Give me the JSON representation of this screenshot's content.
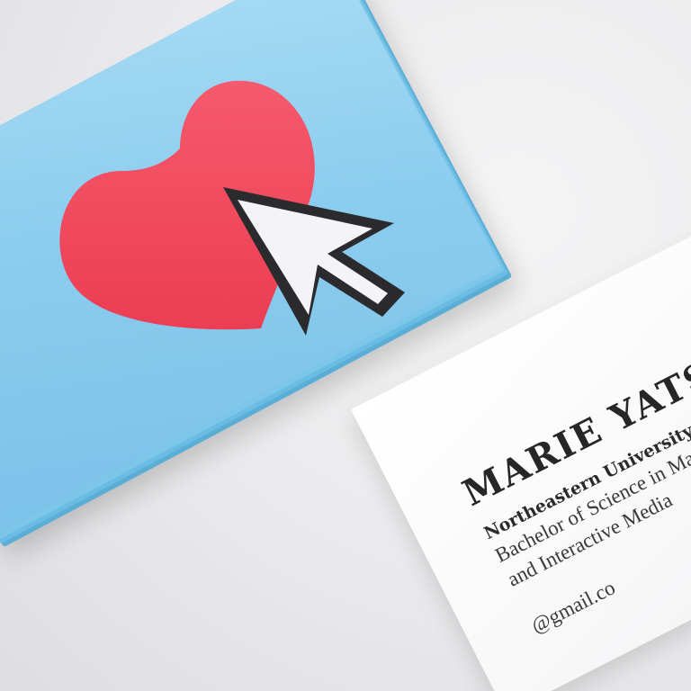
{
  "white_card": {
    "name": "MARIE YATSYK",
    "school": "Northeastern University Class",
    "degree_line1": "Bachelor of Science in Marke",
    "degree_line2": "and Interactive Media",
    "email_partial": "@gmail.co"
  },
  "blue_card": {
    "graphic": "heart-with-cursor",
    "colors": {
      "card": "#8dcdef",
      "heart": "#f04a5e",
      "cursor_fill": "#f4f4f6",
      "cursor_outline": "#2b2b2d"
    }
  }
}
